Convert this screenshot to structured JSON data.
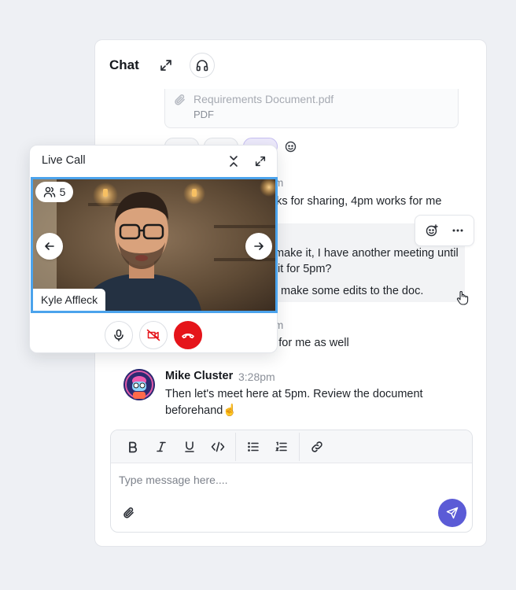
{
  "chat": {
    "title": "Chat",
    "attachment": {
      "file_name": "Requirements Document.pdf",
      "file_type": "PDF"
    },
    "messages": [
      {
        "time_fragment": "m",
        "text_fragment": "nks for sharing, 4pm works for me"
      },
      {
        "text_fragment_1": "make it, I have another meeting until",
        "text_fragment_2": "it for 5pm?",
        "text_fragment_3": "make some edits to the doc."
      },
      {
        "time_fragment": "m",
        "text_fragment": "k for me as well"
      }
    ],
    "last_message": {
      "sender": "Mike Cluster",
      "time": "3:28pm",
      "line1": "Then let's meet here at 5pm. Review the document",
      "line2": "beforehand☝️"
    },
    "composer": {
      "placeholder": "Type message here...."
    }
  },
  "live_call": {
    "title": "Live Call",
    "participant_count": "5",
    "speaker_name": "Kyle Affleck"
  },
  "colors": {
    "send_button": "#5b5bd6",
    "end_call": "#e5141a",
    "video_border": "#4ba3ec"
  },
  "icons": [
    "expand-icon",
    "headphones-icon",
    "paperclip-icon",
    "emoji-add-icon",
    "more-icon",
    "collapse-icon",
    "users-icon",
    "arrow-left-icon",
    "arrow-right-icon",
    "mic-icon",
    "video-off-icon",
    "phone-end-icon",
    "bold-icon",
    "italic-icon",
    "underline-icon",
    "code-icon",
    "bullet-list-icon",
    "numbered-list-icon",
    "link-icon",
    "send-icon"
  ]
}
